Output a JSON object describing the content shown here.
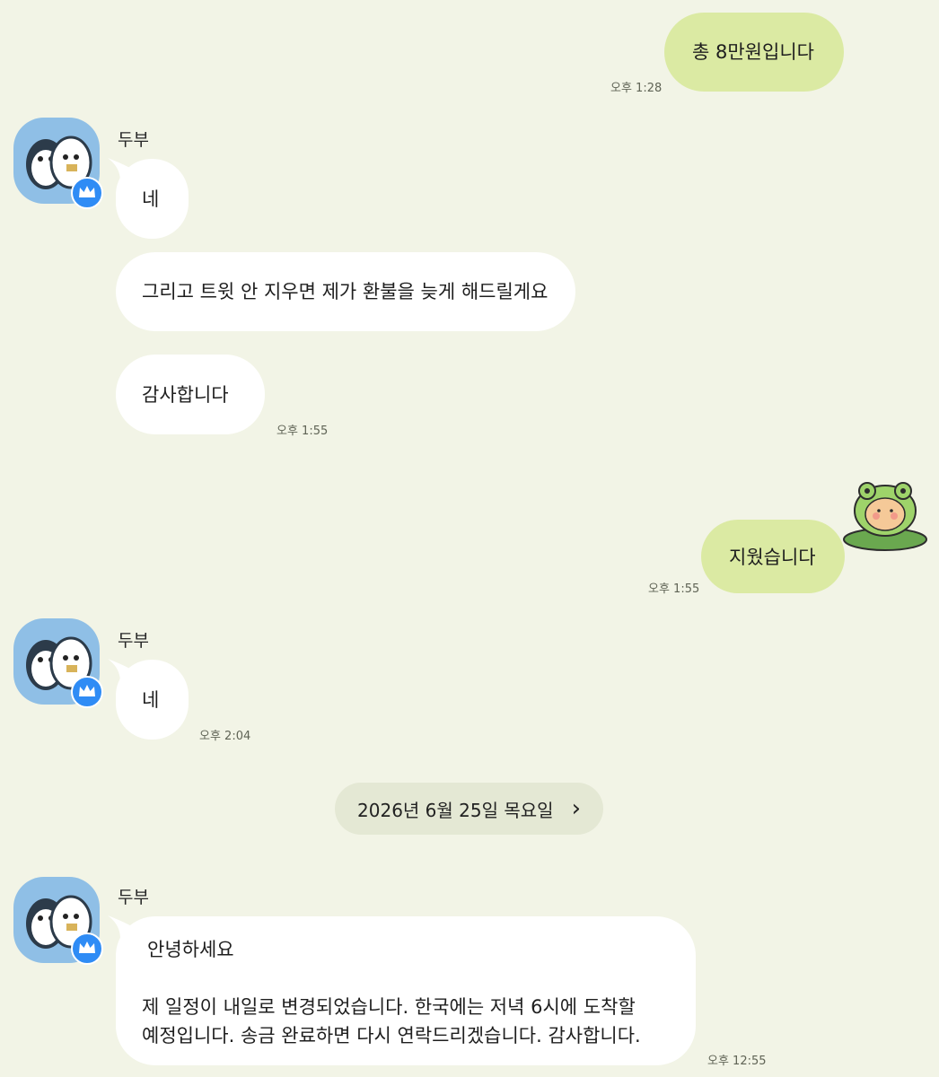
{
  "messages": {
    "m1": {
      "text": "총 8만원입니다",
      "time": "오후 1:28"
    },
    "g1": {
      "sender": "두부",
      "m2": "네",
      "m3": "그리고 트윗 안 지우면 제가 환불을 늦게 해드릴게요",
      "m4": "감사합니다",
      "time": "오후 1:55"
    },
    "m5": {
      "text": "지웠습니다",
      "time": "오후 1:55"
    },
    "g2": {
      "sender": "두부",
      "m6": "네",
      "time": "오후 2:04"
    },
    "date_divider": {
      "label": "2026년 6월 25일 목요일",
      "chevron": "›"
    },
    "g3": {
      "sender": "두부",
      "line1": "안녕하세요",
      "line2": "제 일정이 내일로 변경되었습니다. 한국에는 저녁 6시에 도착할",
      "line3": "예정입니다. 송금 완료하면 다시 연락드리겠습니다. 감사합니다.",
      "time": "오후 12:55"
    }
  },
  "icons": {
    "avatar": "penguin-duo-avatar",
    "badge": "crown-icon",
    "sticker": "frog-hood-bear-sticker"
  },
  "colors": {
    "background": "#f2f4e6",
    "outgoing_bubble": "#dbeaa3",
    "incoming_bubble": "#ffffff",
    "badge": "#2f8cf5"
  }
}
